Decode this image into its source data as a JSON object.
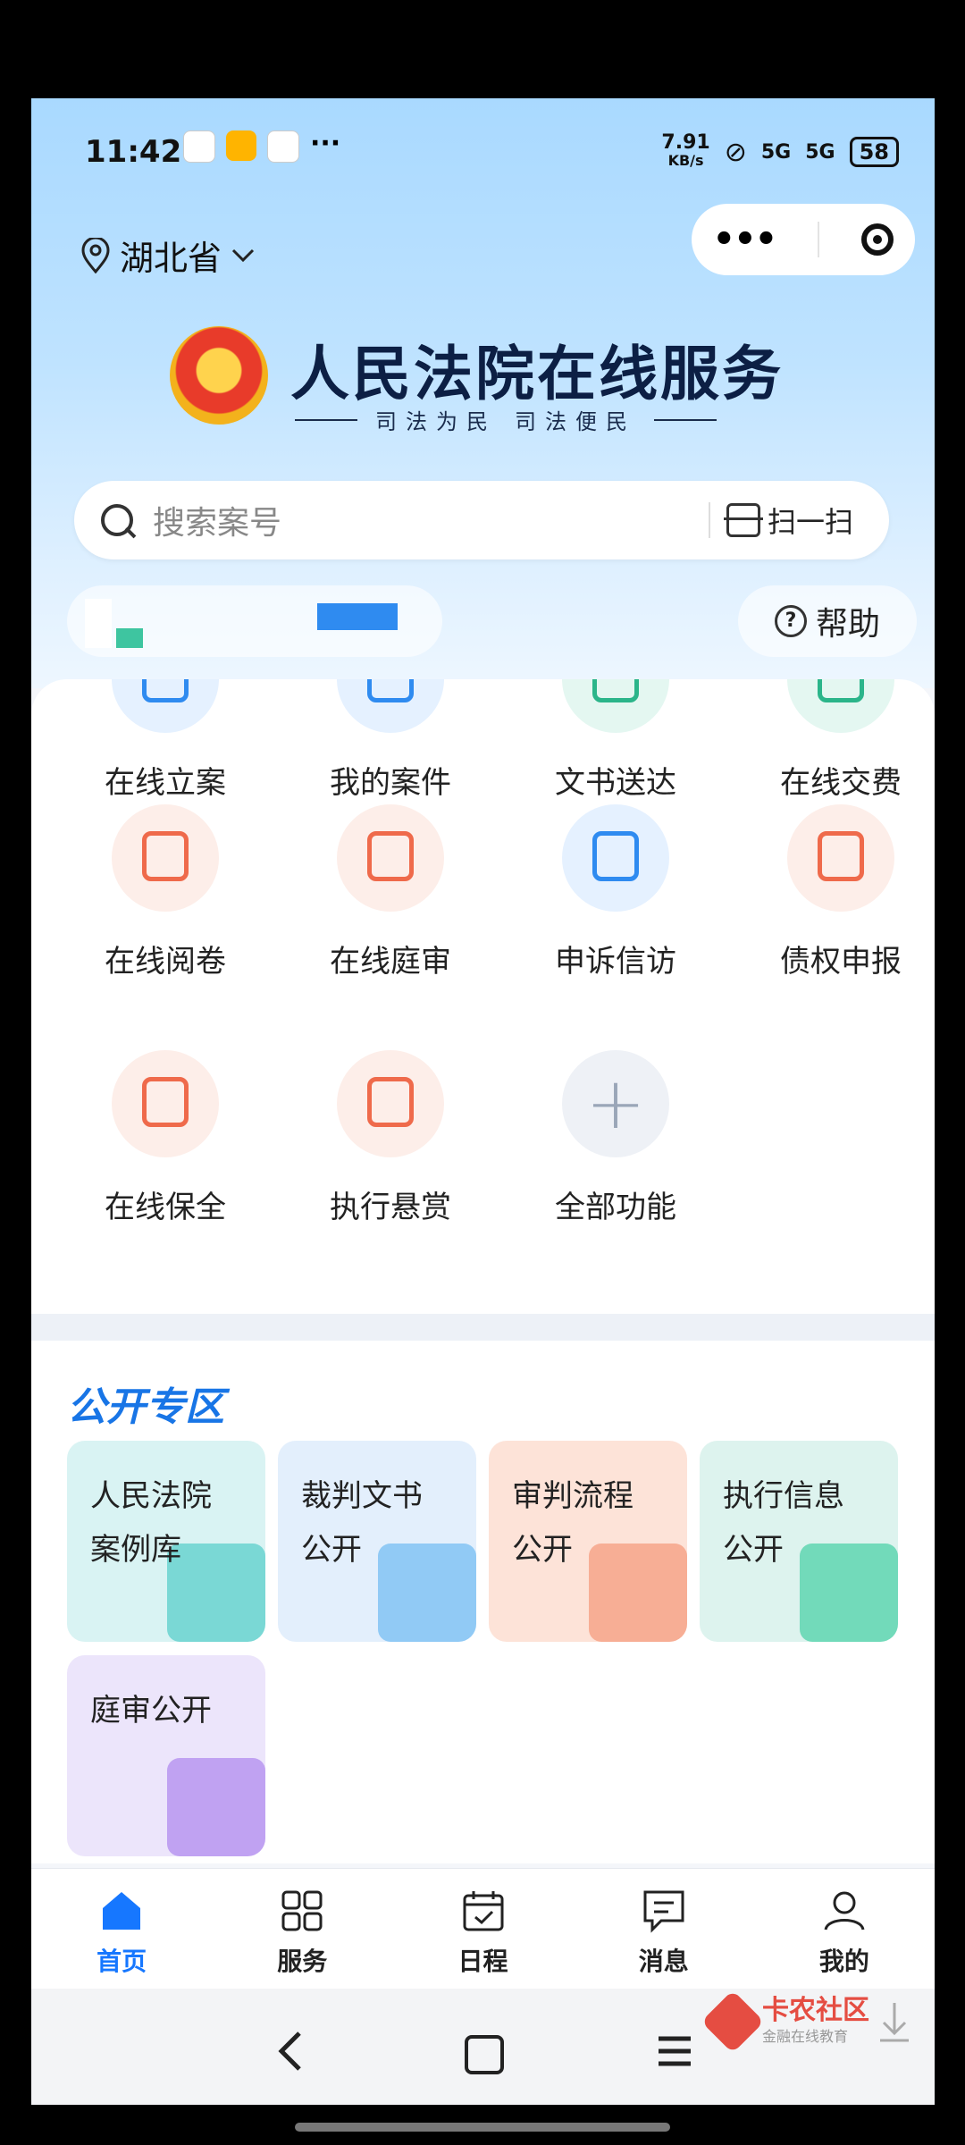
{
  "status_bar": {
    "time": "11:42",
    "net_speed": "7.91",
    "net_speed_unit": "KB/s",
    "signal1": "5G",
    "signal2": "5G",
    "battery": "58",
    "more": "···"
  },
  "header": {
    "location": "湖北省",
    "capsule_more": "•••"
  },
  "brand": {
    "title": "人民法院在线服务",
    "slogan_left": "司法为民",
    "slogan_right": "司法便民"
  },
  "search": {
    "placeholder": "搜索案号",
    "scan_label": "扫一扫"
  },
  "help": {
    "label": "帮助"
  },
  "functions": [
    {
      "label": "在线立案",
      "icon": "file-icon",
      "color": "#2f8bf0",
      "bg": "#e5f1ff"
    },
    {
      "label": "我的案件",
      "icon": "folder-icon",
      "color": "#2f8bf0",
      "bg": "#e5f1ff"
    },
    {
      "label": "文书送达",
      "icon": "mail-check-icon",
      "color": "#2bb58a",
      "bg": "#e4f7f1"
    },
    {
      "label": "在线交费",
      "icon": "payment-icon",
      "color": "#2bb58a",
      "bg": "#e4f7f1"
    },
    {
      "label": "在线阅卷",
      "icon": "reading-icon",
      "color": "#ef6a4b",
      "bg": "#fdeee9"
    },
    {
      "label": "在线庭审",
      "icon": "gavel-monitor-icon",
      "color": "#ef6a4b",
      "bg": "#fdeee9"
    },
    {
      "label": "申诉信访",
      "icon": "petition-icon",
      "color": "#2f8bf0",
      "bg": "#e5f1ff"
    },
    {
      "label": "债权申报",
      "icon": "yuan-document-icon",
      "color": "#ef6a4b",
      "bg": "#fdeee9"
    },
    {
      "label": "在线保全",
      "icon": "shield-icon",
      "color": "#ef6a4b",
      "bg": "#fdeee9"
    },
    {
      "label": "执行悬赏",
      "icon": "money-bag-icon",
      "color": "#ef6a4b",
      "bg": "#fdeee9"
    },
    {
      "label": "全部功能",
      "icon": "plus-icon",
      "color": "#9aa6b8",
      "bg": "#eef1f6"
    }
  ],
  "public_section": {
    "title": "公开专区",
    "cards": [
      {
        "line1": "人民法院",
        "line2": "案例库",
        "bg": "#d9f3f3",
        "accent": "#69d2cf"
      },
      {
        "line1": "裁判文书",
        "line2": "公开",
        "bg": "#e3effc",
        "accent": "#83c3f3"
      },
      {
        "line1": "审判流程",
        "line2": "公开",
        "bg": "#fde3d8",
        "accent": "#f6a58a"
      },
      {
        "line1": "执行信息",
        "line2": "公开",
        "bg": "#ddf3ee",
        "accent": "#5fd5b0"
      },
      {
        "line1": "庭审公开",
        "line2": "",
        "bg": "#ece5fb",
        "accent": "#b896f0"
      }
    ]
  },
  "tabbar": [
    {
      "label": "首页",
      "icon": "home-icon",
      "active": true
    },
    {
      "label": "服务",
      "icon": "grid-icon",
      "active": false
    },
    {
      "label": "日程",
      "icon": "calendar-icon",
      "active": false
    },
    {
      "label": "消息",
      "icon": "message-icon",
      "active": false
    },
    {
      "label": "我的",
      "icon": "user-icon",
      "active": false
    }
  ],
  "watermark": {
    "name": "卡农社区",
    "sub": "金融在线教育"
  },
  "colors": {
    "primary": "#1677ff",
    "hero_top": "#a9d9ff"
  }
}
